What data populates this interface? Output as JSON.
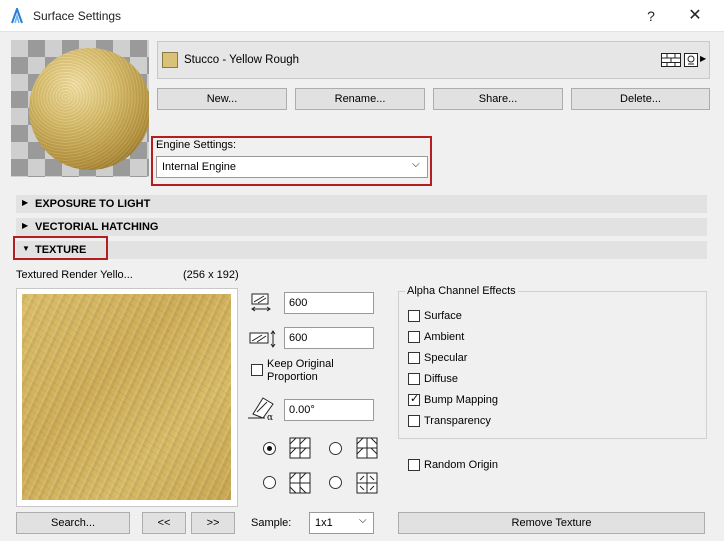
{
  "window": {
    "title": "Surface Settings",
    "help_glyph": "?",
    "close_glyph": "✕"
  },
  "material": {
    "name": "Stucco - Yellow Rough",
    "swatch_color": "#d9c277"
  },
  "actions": {
    "new": "New...",
    "rename": "Rename...",
    "share": "Share...",
    "delete": "Delete..."
  },
  "engine": {
    "label": "Engine Settings:",
    "value": "Internal Engine"
  },
  "sections": {
    "exposure": "EXPOSURE TO LIGHT",
    "hatching": "VECTORIAL HATCHING",
    "texture": "TEXTURE"
  },
  "texture": {
    "name": "Textured Render Yello...",
    "size": "(256 x 192)",
    "width": "600",
    "height": "600",
    "keep_proportion": "Keep Original Proportion",
    "angle": "0.00°"
  },
  "alpha": {
    "title": "Alpha Channel Effects",
    "options": [
      {
        "label": "Surface",
        "checked": false
      },
      {
        "label": "Ambient",
        "checked": false
      },
      {
        "label": "Specular",
        "checked": false
      },
      {
        "label": "Diffuse",
        "checked": false
      },
      {
        "label": "Bump Mapping",
        "checked": true
      },
      {
        "label": "Transparency",
        "checked": false
      }
    ],
    "random_origin": "Random Origin"
  },
  "bottom": {
    "search": "Search...",
    "prev": "<<",
    "next": ">>",
    "sample_label": "Sample:",
    "sample_value": "1x1",
    "remove": "Remove Texture"
  },
  "colors": {
    "highlight": "#b41e1e"
  }
}
